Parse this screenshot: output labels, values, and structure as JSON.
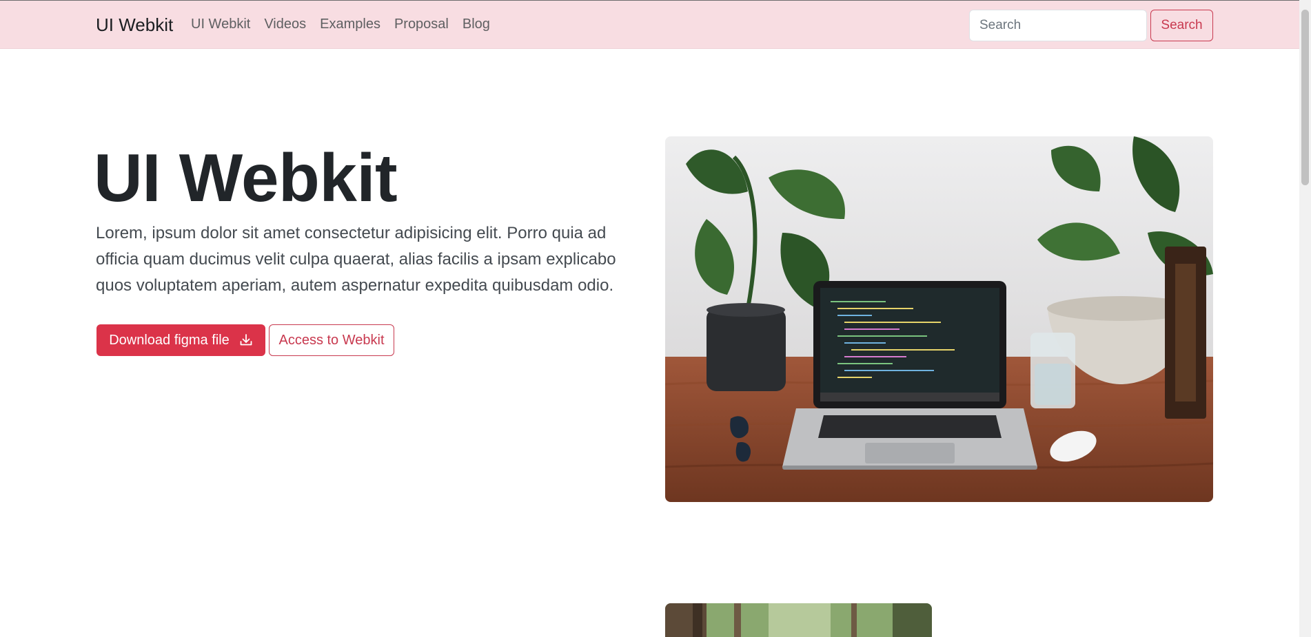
{
  "navbar": {
    "brand": "UI Webkit",
    "links": [
      "UI Webkit",
      "Videos",
      "Examples",
      "Proposal",
      "Blog"
    ],
    "search_placeholder": "Search",
    "search_button": "Search"
  },
  "hero": {
    "title": "UI Webkit",
    "text": "Lorem, ipsum dolor sit amet consectetur adipisicing elit. Porro quia ad officia quam ducimus velit culpa quaerat, alias facilis a ipsam explicabo quos voluptatem aperiam, autem aspernatur expedita quibusdam odio.",
    "primary_button": "Download figma file",
    "secondary_button": "Access to Webkit"
  },
  "colors": {
    "navbar_bg": "#f8dde2",
    "accent": "#db3349",
    "accent_outline": "#c8394f"
  },
  "icons": {
    "download": "download-icon"
  }
}
